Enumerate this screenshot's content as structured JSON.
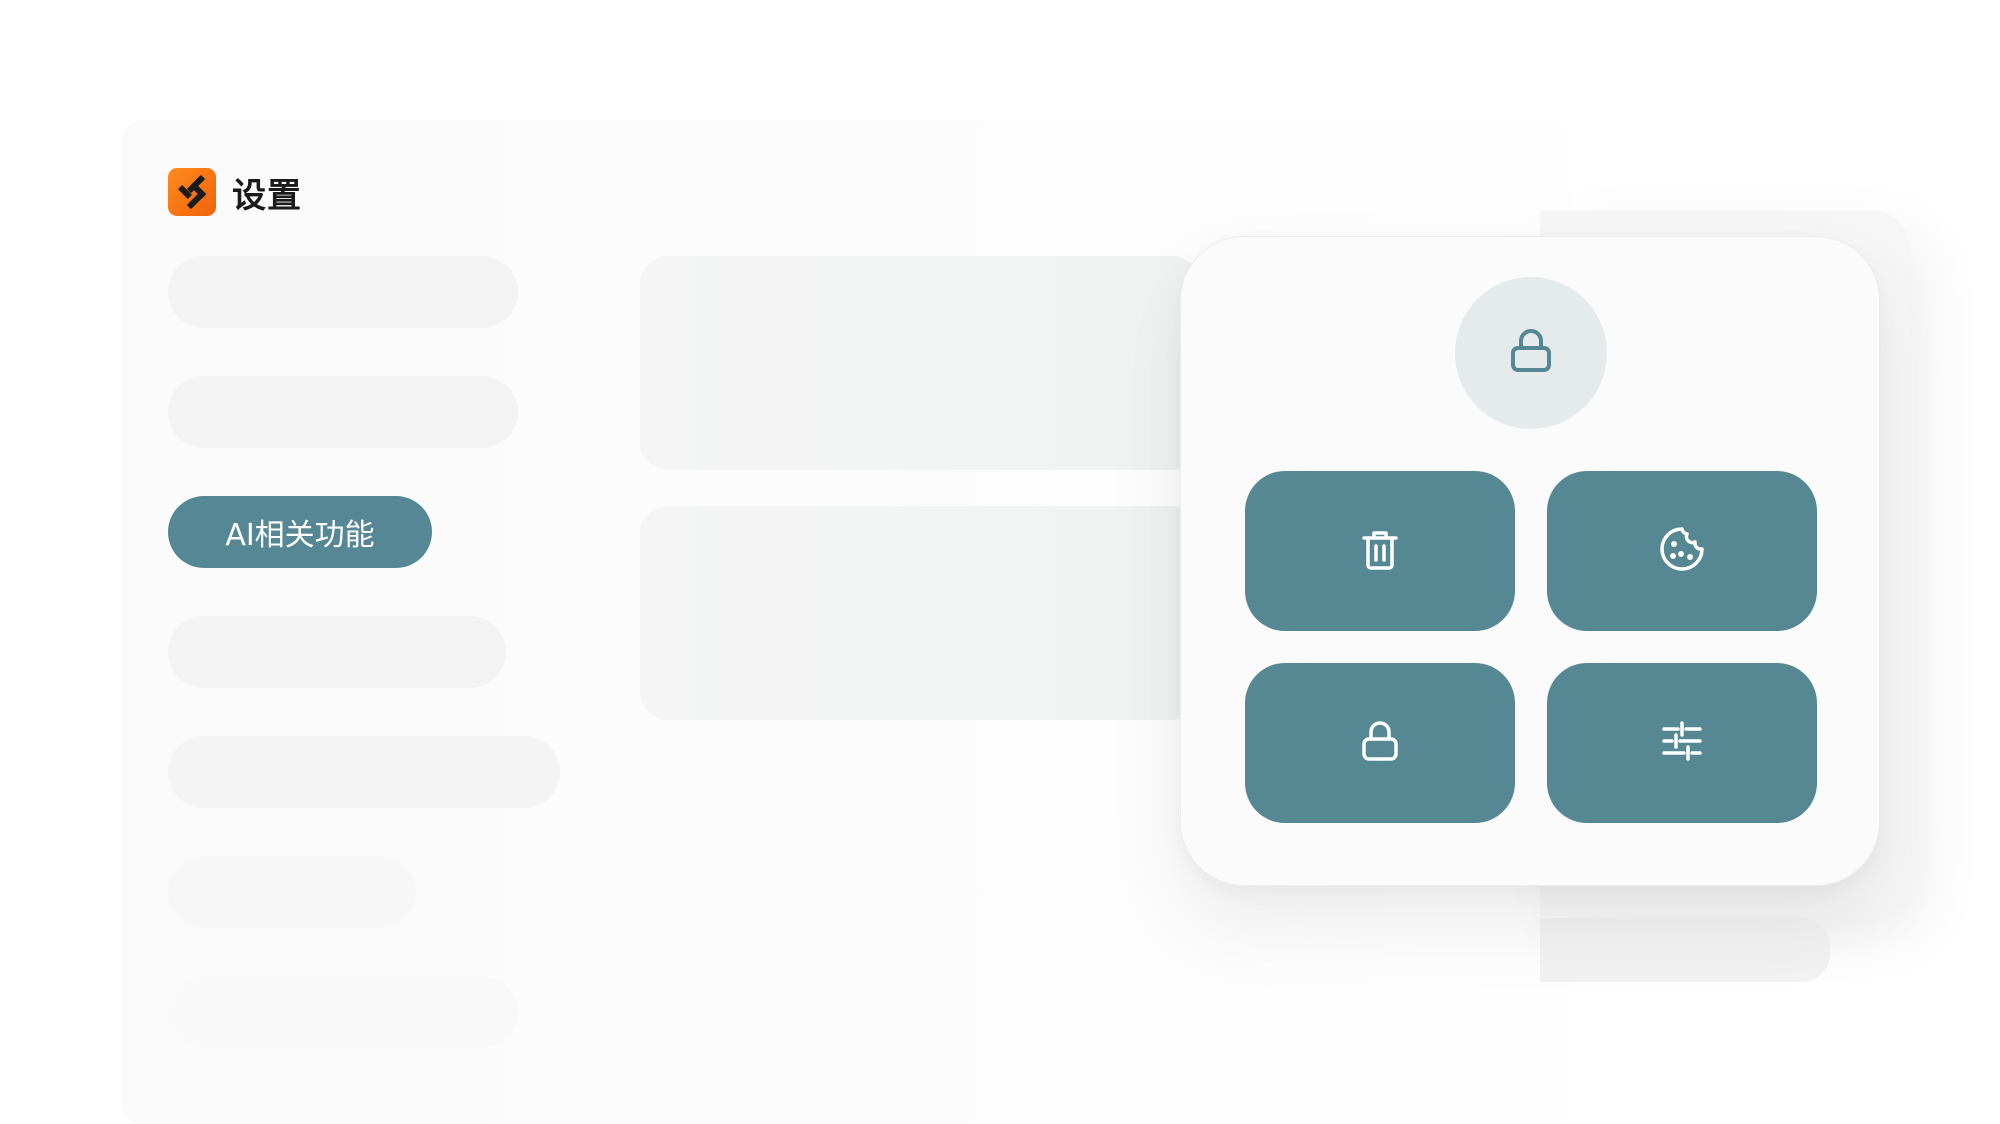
{
  "header": {
    "title": "设置",
    "logo_icon": "app-logo-icon"
  },
  "sidebar": {
    "items": [
      {
        "label": "",
        "active": false
      },
      {
        "label": "",
        "active": false
      },
      {
        "label": "AI相关功能",
        "active": true
      },
      {
        "label": "",
        "active": false
      },
      {
        "label": "",
        "active": false
      },
      {
        "label": "",
        "active": false
      },
      {
        "label": "",
        "active": false
      },
      {
        "label": "",
        "active": false
      }
    ]
  },
  "popover": {
    "header_icon": "lock-icon",
    "tiles": [
      {
        "icon": "trash-icon"
      },
      {
        "icon": "cookie-icon"
      },
      {
        "icon": "lock-icon"
      },
      {
        "icon": "sliders-icon"
      }
    ]
  },
  "colors": {
    "accent": "#568794",
    "logo": "#f26e10",
    "lock_circle": "#e5eaeb",
    "icon_on_circle": "#568794",
    "icon_on_tile": "#ffffff"
  }
}
